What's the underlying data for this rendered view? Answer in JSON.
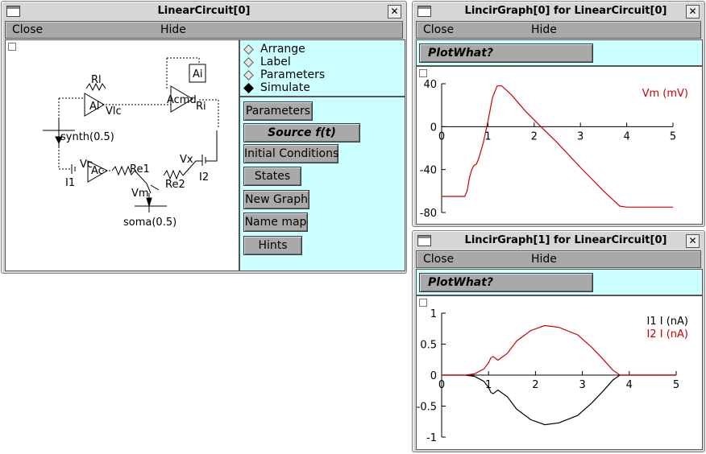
{
  "circuit_window": {
    "title": "LinearCircuit[0]",
    "menu": {
      "close": "Close",
      "hide": "Hide"
    },
    "modes": [
      {
        "label": "Arrange",
        "selected": false
      },
      {
        "label": "Label",
        "selected": false
      },
      {
        "label": "Parameters",
        "selected": false
      },
      {
        "label": "Simulate",
        "selected": true
      }
    ],
    "buttons": {
      "parameters": "Parameters",
      "source": "Source f(t)",
      "initial_conditions": "Initial Conditions",
      "states": "States",
      "new_graph": "New Graph",
      "name_map": "Name map",
      "hints": "Hints"
    },
    "diagram_labels": {
      "rl": "Rl",
      "al1": "Al",
      "vlc": "Vlc",
      "ai": "Ai",
      "acmd": "Acmd",
      "ri": "Ri",
      "synth": "synth(0.5)",
      "vc": "Vc",
      "ac": "Ac",
      "re1": "Re1",
      "i1": "I1",
      "vm": "Vm",
      "re2": "Re2",
      "vx": "Vx",
      "i2": "I2",
      "soma": "soma(0.5)"
    }
  },
  "graph0_window": {
    "title": "LincirGraph[0] for LinearCircuit[0]",
    "menu": {
      "close": "Close",
      "hide": "Hide"
    },
    "plot_what": "PlotWhat?"
  },
  "graph1_window": {
    "title": "LincirGraph[1] for LinearCircuit[0]",
    "menu": {
      "close": "Close",
      "hide": "Hide"
    },
    "plot_what": "PlotWhat?"
  },
  "chart_data": [
    {
      "type": "line",
      "xlim": [
        0,
        5
      ],
      "ylim": [
        -80,
        40
      ],
      "x_ticks": [
        "0",
        "1",
        "2",
        "3",
        "4",
        "5"
      ],
      "y_ticks": [
        "40",
        "0",
        "-40",
        "-80"
      ],
      "grid": false,
      "legend_position": "top-right",
      "series": [
        {
          "name": "Vm (mV)",
          "color": "#cc0000",
          "points": [
            [
              0,
              -65
            ],
            [
              0.5,
              -65
            ],
            [
              0.52,
              -63
            ],
            [
              0.55,
              -60
            ],
            [
              0.6,
              -48
            ],
            [
              0.65,
              -40
            ],
            [
              0.7,
              -36
            ],
            [
              0.75,
              -35
            ],
            [
              0.8,
              -30
            ],
            [
              0.9,
              -15
            ],
            [
              1.0,
              5
            ],
            [
              1.1,
              27
            ],
            [
              1.2,
              38
            ],
            [
              1.3,
              38
            ],
            [
              1.5,
              30
            ],
            [
              1.8,
              15
            ],
            [
              2.1,
              2
            ],
            [
              2.5,
              -15
            ],
            [
              3.0,
              -38
            ],
            [
              3.5,
              -60
            ],
            [
              3.75,
              -70
            ],
            [
              3.85,
              -74
            ],
            [
              4.0,
              -75
            ],
            [
              4.5,
              -75
            ],
            [
              5.0,
              -75
            ]
          ]
        }
      ]
    },
    {
      "type": "line",
      "xlim": [
        0,
        5
      ],
      "ylim": [
        -1,
        1
      ],
      "x_ticks": [
        "0",
        "1",
        "2",
        "3",
        "4",
        "5"
      ],
      "y_ticks": [
        "1",
        "0.5",
        "0",
        "-0.5",
        "-1"
      ],
      "grid": false,
      "legend_position": "top-right",
      "series": [
        {
          "name": "I1 I (nA)",
          "color": "#000000",
          "points": [
            [
              0,
              0
            ],
            [
              0.5,
              0
            ],
            [
              0.7,
              -0.02
            ],
            [
              0.9,
              -0.1
            ],
            [
              1.0,
              -0.2
            ],
            [
              1.05,
              -0.28
            ],
            [
              1.1,
              -0.3
            ],
            [
              1.2,
              -0.24
            ],
            [
              1.4,
              -0.35
            ],
            [
              1.6,
              -0.55
            ],
            [
              1.9,
              -0.72
            ],
            [
              2.2,
              -0.8
            ],
            [
              2.5,
              -0.77
            ],
            [
              2.9,
              -0.65
            ],
            [
              3.2,
              -0.45
            ],
            [
              3.45,
              -0.25
            ],
            [
              3.65,
              -0.08
            ],
            [
              3.8,
              0
            ],
            [
              5.0,
              0
            ]
          ]
        },
        {
          "name": "I2 I (nA)",
          "color": "#cc0000",
          "points": [
            [
              0,
              0
            ],
            [
              0.5,
              0
            ],
            [
              0.7,
              0.02
            ],
            [
              0.9,
              0.1
            ],
            [
              1.0,
              0.2
            ],
            [
              1.05,
              0.28
            ],
            [
              1.1,
              0.3
            ],
            [
              1.2,
              0.24
            ],
            [
              1.4,
              0.35
            ],
            [
              1.6,
              0.55
            ],
            [
              1.9,
              0.72
            ],
            [
              2.2,
              0.8
            ],
            [
              2.5,
              0.77
            ],
            [
              2.9,
              0.65
            ],
            [
              3.2,
              0.45
            ],
            [
              3.45,
              0.25
            ],
            [
              3.65,
              0.08
            ],
            [
              3.8,
              0
            ],
            [
              5.0,
              0
            ]
          ]
        }
      ]
    }
  ]
}
